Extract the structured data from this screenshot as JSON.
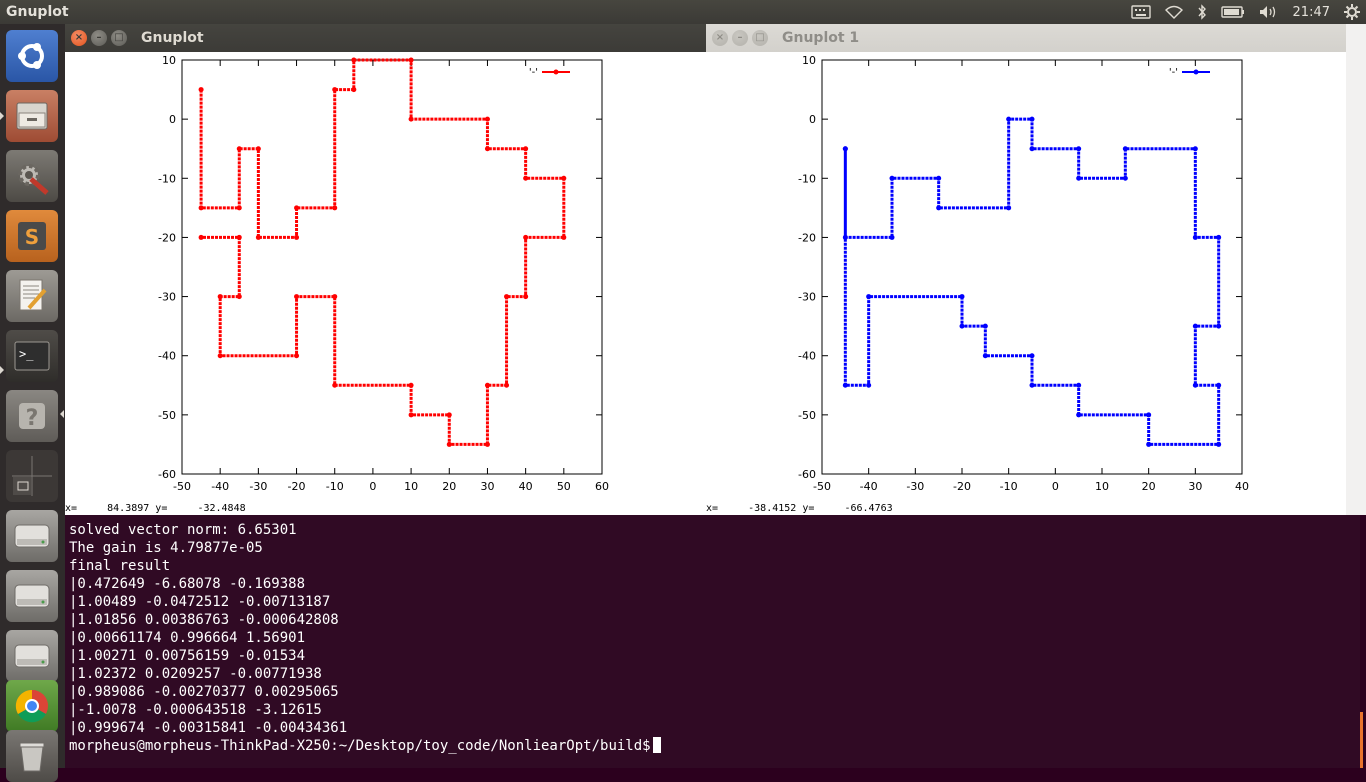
{
  "top_panel": {
    "title": "Gnuplot",
    "clock": "21:47"
  },
  "launcher": {
    "items": [
      {
        "name": "ubuntu-logo-icon"
      },
      {
        "name": "files-icon"
      },
      {
        "name": "system-settings-icon"
      },
      {
        "name": "sublime-text-icon"
      },
      {
        "name": "text-editor-icon"
      },
      {
        "name": "terminal-icon"
      },
      {
        "name": "help-icon"
      },
      {
        "name": "workspace-switcher-icon"
      },
      {
        "name": "drive-icon"
      },
      {
        "name": "drive-icon"
      },
      {
        "name": "drive-icon"
      },
      {
        "name": "chrome-icon"
      },
      {
        "name": "trash-icon"
      }
    ]
  },
  "window_left": {
    "title": "Gnuplot",
    "coords": "x=     84.3897 y=     -32.4848",
    "legend": "'-'",
    "series_color": "#ff0000"
  },
  "window_right": {
    "title": "Gnuplot 1",
    "coords": "x=     -38.4152 y=     -66.4763",
    "legend": "'-'",
    "series_color": "#0000ff"
  },
  "terminal": {
    "lines": [
      "solved vector norm: 6.65301",
      "The gain is 4.79877e-05",
      "final result",
      "|0.472649 -6.68078 -0.169388",
      "|1.00489 -0.0472512 -0.00713187",
      "|1.01856 0.00386763 -0.000642808",
      "|0.00661174 0.996664 1.56901",
      "|1.00271 0.00756159 -0.01534",
      "|1.02372 0.0209257 -0.00771938",
      "|0.989086 -0.00270377 0.00295065",
      "|-1.0078 -0.000643518 -3.12615",
      "|0.999674 -0.00315841 -0.00434361"
    ],
    "prompt": "morpheus@morpheus-ThinkPad-X250:~/Desktop/toy_code/NonliearOpt/build$"
  },
  "chart_data": [
    {
      "type": "line",
      "title": "",
      "xlabel": "",
      "ylabel": "",
      "xlim": [
        -50,
        60
      ],
      "ylim": [
        -60,
        10
      ],
      "xticks": [
        -50,
        -40,
        -30,
        -20,
        -10,
        0,
        10,
        20,
        30,
        40,
        50,
        60
      ],
      "yticks": [
        10,
        0,
        -10,
        -20,
        -30,
        -40,
        -50,
        -60
      ],
      "legend": "'-'",
      "legend_position": "top-right",
      "series": [
        {
          "color": "#ff0000",
          "x": [
            -45,
            -45,
            -35,
            -35,
            -30,
            -30,
            -20,
            -20,
            -10,
            -10,
            -5,
            -5,
            10,
            10,
            30,
            30,
            40,
            40,
            50,
            50,
            40,
            40,
            35,
            35,
            30,
            30,
            20,
            20,
            10,
            10,
            -10,
            -10,
            -20,
            -20,
            -40,
            -40,
            -35,
            -35,
            -45
          ],
          "y": [
            5,
            -15,
            -15,
            -5,
            -5,
            -20,
            -20,
            -15,
            -15,
            5,
            5,
            10,
            10,
            0,
            0,
            -5,
            -5,
            -10,
            -10,
            -20,
            -20,
            -30,
            -30,
            -45,
            -45,
            -55,
            -55,
            -50,
            -50,
            -45,
            -45,
            -30,
            -30,
            -40,
            -40,
            -30,
            -30,
            -20,
            -20
          ]
        }
      ]
    },
    {
      "type": "line",
      "title": "",
      "xlabel": "",
      "ylabel": "",
      "xlim": [
        -50,
        40
      ],
      "ylim": [
        -60,
        10
      ],
      "xticks": [
        -50,
        -40,
        -30,
        -20,
        -10,
        0,
        10,
        20,
        30,
        40
      ],
      "yticks": [
        10,
        0,
        -10,
        -20,
        -30,
        -40,
        -50,
        -60
      ],
      "legend": "'-'",
      "legend_position": "top-right",
      "series": [
        {
          "color": "#0000ff",
          "x": [
            -45,
            -45,
            -35,
            -35,
            -25,
            -25,
            -10,
            -10,
            -5,
            -5,
            5,
            5,
            15,
            15,
            30,
            30,
            35,
            35,
            30,
            30,
            35,
            35,
            20,
            20,
            5,
            5,
            -5,
            -5,
            -15,
            -15,
            -20,
            -20,
            -40,
            -40,
            -45,
            -45
          ],
          "y": [
            -5,
            -20,
            -20,
            -10,
            -10,
            -15,
            -15,
            0,
            0,
            -5,
            -5,
            -10,
            -10,
            -5,
            -5,
            -20,
            -20,
            -35,
            -35,
            -45,
            -45,
            -55,
            -55,
            -50,
            -50,
            -45,
            -45,
            -40,
            -40,
            -35,
            -35,
            -30,
            -30,
            -45,
            -45,
            -5
          ]
        }
      ]
    }
  ]
}
